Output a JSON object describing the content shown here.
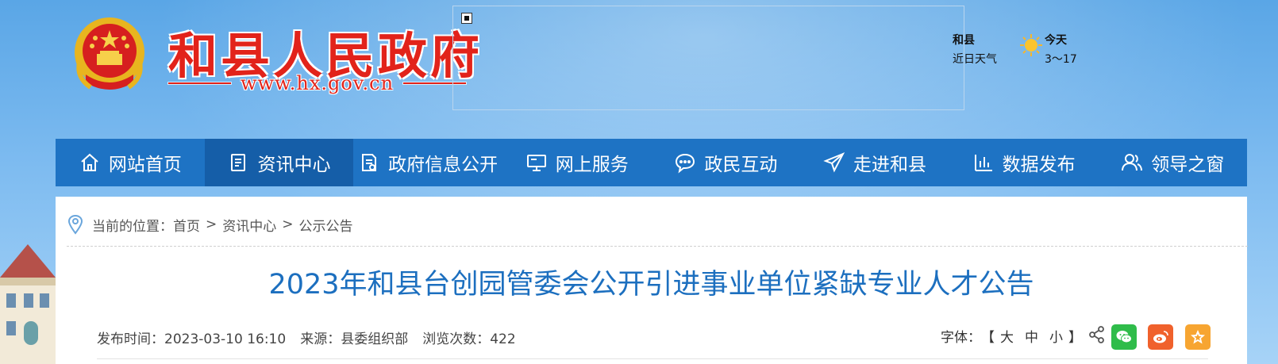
{
  "header": {
    "site_title": "和县人民政府",
    "site_url": "www.hx.gov.cn"
  },
  "weather": {
    "city": "和县",
    "label": "近日天气",
    "day": "今天",
    "temp": "3～17",
    "icon": "sun-icon"
  },
  "nav": {
    "items": [
      {
        "label": "网站首页",
        "icon": "home-icon"
      },
      {
        "label": "资讯中心",
        "icon": "document-icon",
        "active": true
      },
      {
        "label": "政府信息公开",
        "icon": "file-list-icon"
      },
      {
        "label": "网上服务",
        "icon": "monitor-icon"
      },
      {
        "label": "政民互动",
        "icon": "chat-icon"
      },
      {
        "label": "走进和县",
        "icon": "paper-plane-icon"
      },
      {
        "label": "数据发布",
        "icon": "bar-chart-icon"
      },
      {
        "label": "领导之窗",
        "icon": "users-icon"
      }
    ]
  },
  "breadcrumb": {
    "prefix": "当前的位置：",
    "items": [
      "首页",
      "资讯中心",
      "公示公告"
    ],
    "separator": ">"
  },
  "article": {
    "title": "2023年和县台创园管委会公开引进事业单位紧缺专业人才公告",
    "publish_label": "发布时间：",
    "publish_time": "2023-03-10 16:10",
    "source_label": "来源：",
    "source": "县委组织部",
    "views_label": "浏览次数：",
    "views": "422"
  },
  "font_size": {
    "label": "字体：",
    "open": "【",
    "large": "大",
    "medium": "中",
    "small": "小",
    "close": "】"
  },
  "colors": {
    "nav_bg": "#1e73c4",
    "nav_active": "#155ea8",
    "title_blue": "#1c6fbf",
    "brand_red": "#e2231a",
    "wechat": "#2fbc4a",
    "weibo": "#f0612c",
    "favorite": "#f7a531"
  }
}
